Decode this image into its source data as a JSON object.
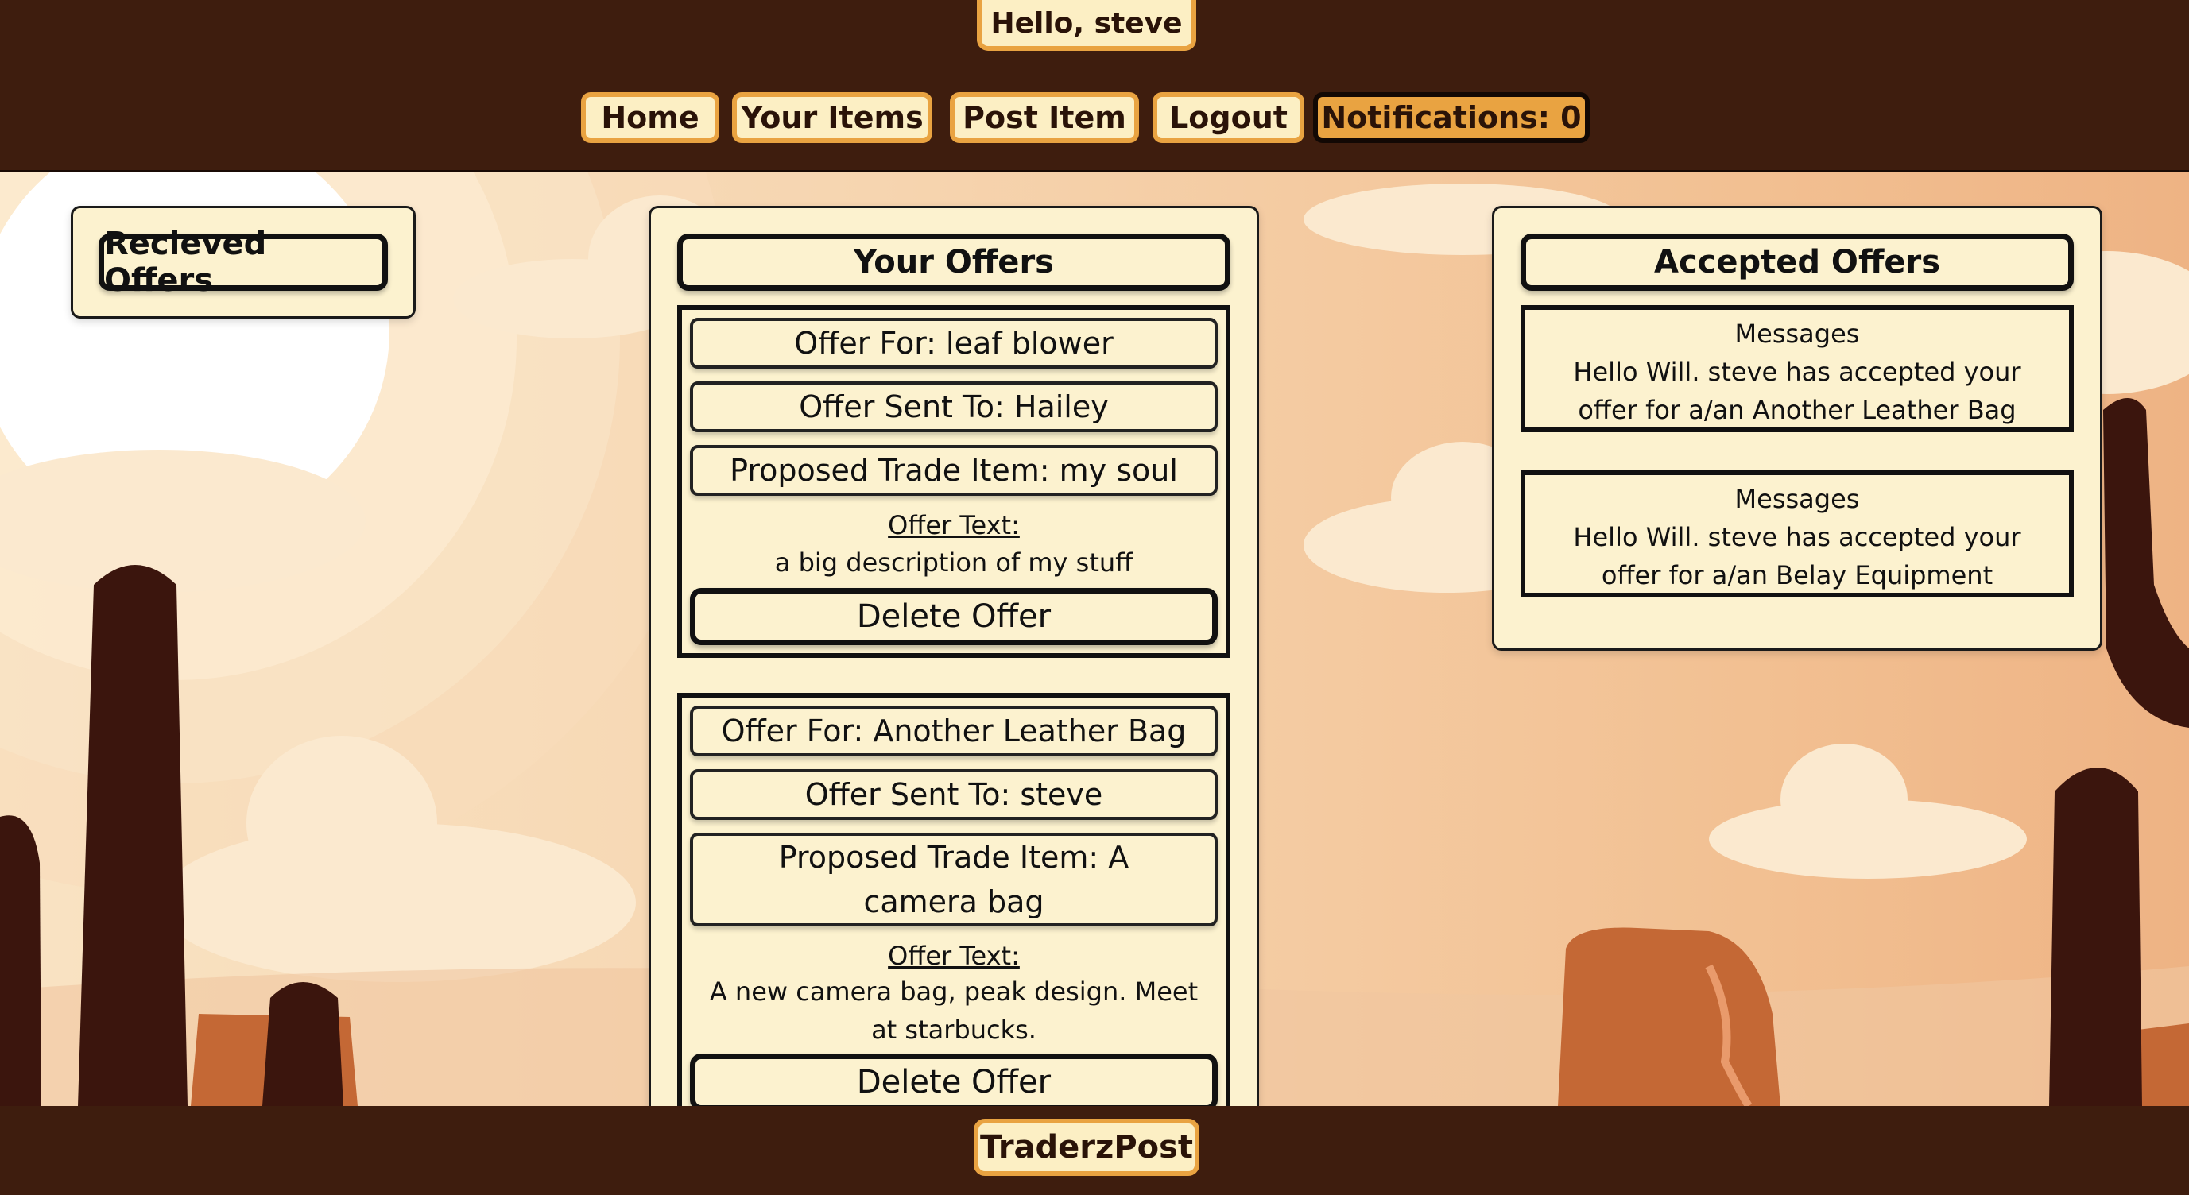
{
  "header": {
    "greeting": "Hello, steve",
    "nav": {
      "home": "Home",
      "your_items": "Your Items",
      "post_item": "Post Item",
      "logout": "Logout",
      "notifications": "Notifications: 0"
    }
  },
  "received": {
    "title": "Recieved Offers"
  },
  "your_offers": {
    "title": "Your Offers",
    "offers": [
      {
        "offer_for": "Offer For: leaf blower",
        "sent_to": "Offer Sent To: Hailey",
        "proposed": "Proposed Trade Item: my soul",
        "offer_text_label": "Offer Text:",
        "offer_text": "a big description of my stuff",
        "delete": "Delete Offer"
      },
      {
        "offer_for": "Offer For: Another Leather Bag",
        "sent_to": "Offer Sent To: steve",
        "proposed": "Proposed Trade Item: A camera bag",
        "offer_text_label": "Offer Text:",
        "offer_text": "A new camera bag, peak design. Meet at starbucks.",
        "delete": "Delete Offer"
      }
    ]
  },
  "accepted": {
    "title": "Accepted Offers",
    "messages": [
      {
        "heading": "Messages",
        "text": "Hello Will. steve has accepted your offer for a/an Another Leather Bag"
      },
      {
        "heading": "Messages",
        "text": "Hello Will. steve has accepted your offer for a/an Belay Equipment"
      }
    ]
  },
  "footer": {
    "brand": "TraderzPost"
  },
  "colors": {
    "header_bg": "#3e1d0e",
    "accent": "#e9a341",
    "panel_bg": "#fcf2cf",
    "cactus": "#3b150d"
  }
}
